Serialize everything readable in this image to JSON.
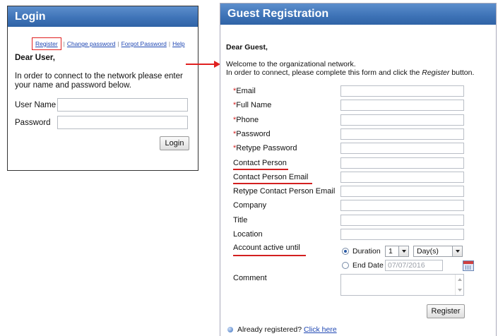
{
  "login": {
    "title": "Login",
    "links": [
      "Register",
      "Change password",
      "Forgot Password",
      "Help"
    ],
    "greeting": "Dear User,",
    "intro": "In order to connect to the network please enter your name and password below.",
    "username_label": "User Name",
    "password_label": "Password",
    "username_value": "",
    "password_value": "",
    "login_button": "Login"
  },
  "guest": {
    "title": "Guest Registration",
    "greeting": "Dear Guest,",
    "welcome": "Welcome to the organizational network.",
    "instruction_pre": "In order to connect, please complete this form and click the ",
    "instruction_em": "Register",
    "instruction_post": " button.",
    "fields": [
      {
        "label": "Email",
        "required": true,
        "value": ""
      },
      {
        "label": "Full Name",
        "required": true,
        "value": ""
      },
      {
        "label": "Phone",
        "required": true,
        "value": ""
      },
      {
        "label": "Password",
        "required": true,
        "value": ""
      },
      {
        "label": "Retype Password",
        "required": true,
        "value": ""
      },
      {
        "label": "Contact Person",
        "required": false,
        "value": ""
      },
      {
        "label": "Contact Person Email",
        "required": false,
        "value": ""
      },
      {
        "label": "Retype Contact Person Email",
        "required": false,
        "value": ""
      },
      {
        "label": "Company",
        "required": false,
        "value": ""
      },
      {
        "label": "Title",
        "required": false,
        "value": ""
      },
      {
        "label": "Location",
        "required": false,
        "value": ""
      }
    ],
    "required_mark": "*",
    "account_active_label": "Account active until",
    "duration_label": "Duration",
    "duration_value": "1",
    "duration_unit": "Day(s)",
    "end_date_label": "End Date",
    "end_date_value": "07/07/2016",
    "comment_label": "Comment",
    "register_button": "Register",
    "already_text": "Already registered?",
    "click_here": "Click here"
  },
  "colors": {
    "header_blue": "#3f74b8",
    "highlight_red": "#e02020",
    "link_blue": "#1f47b3"
  }
}
